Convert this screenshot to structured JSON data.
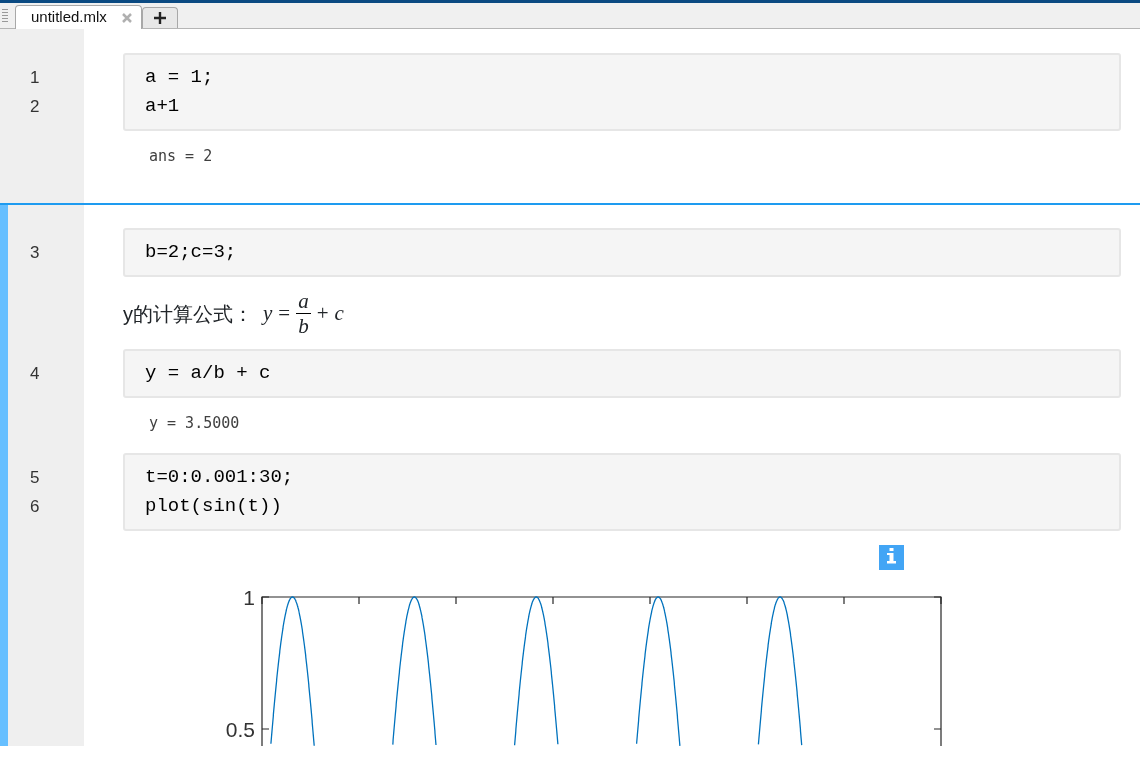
{
  "tabs": [
    {
      "label": "untitled.mlx",
      "selected": true
    }
  ],
  "sections": [
    {
      "selected": false,
      "items": [
        {
          "kind": "code",
          "lines": [
            {
              "number": "1",
              "text": "a = 1;"
            },
            {
              "number": "2",
              "text": "a+1"
            }
          ]
        },
        {
          "kind": "output",
          "text": "ans = 2"
        }
      ]
    },
    {
      "selected": true,
      "items": [
        {
          "kind": "code",
          "lines": [
            {
              "number": "3",
              "text": "b=2;c=3;"
            }
          ]
        },
        {
          "kind": "text",
          "text": "y的计算公式：",
          "equation": {
            "left": "y",
            "relation": "=",
            "numerator": "a",
            "denominator": "b",
            "operator": "+",
            "right": "c"
          }
        },
        {
          "kind": "code",
          "lines": [
            {
              "number": "4",
              "text": "y = a/b + c"
            }
          ]
        },
        {
          "kind": "output",
          "text": "y = 3.5000"
        },
        {
          "kind": "code",
          "lines": [
            {
              "number": "5",
              "text": "t=0:0.001:30;"
            },
            {
              "number": "6",
              "text": "plot(sin(t))"
            }
          ]
        },
        {
          "kind": "figure",
          "tick_labels": [
            "1",
            "0.5"
          ]
        }
      ]
    }
  ]
}
